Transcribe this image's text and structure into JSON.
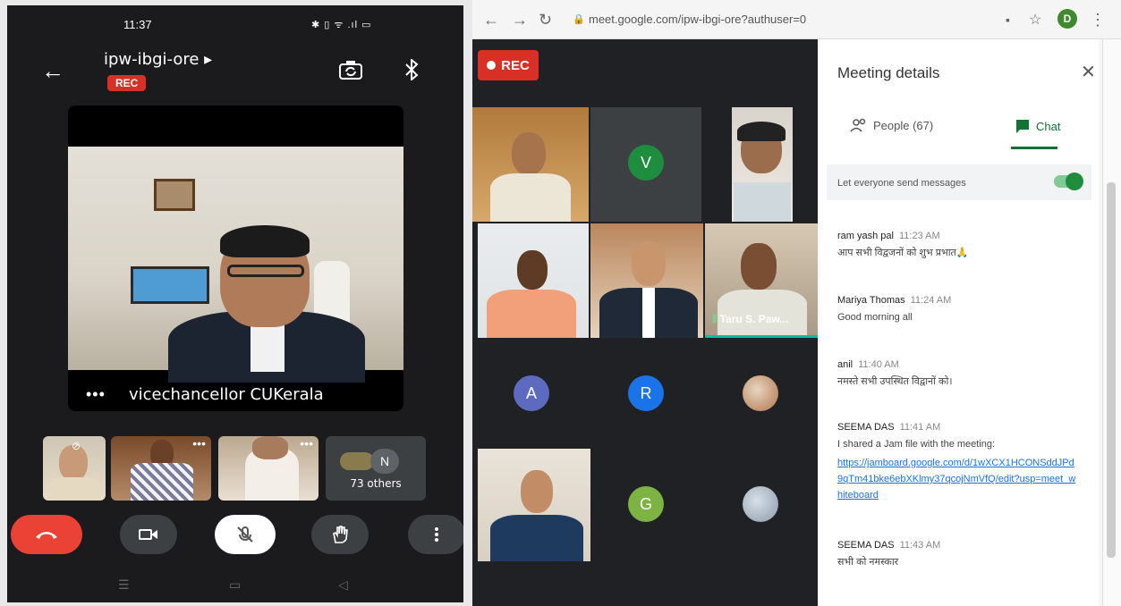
{
  "phone": {
    "status_time": "11:37",
    "status_icons": "✱ ▯ ᯤ .ıl ▭",
    "meeting_code": "ipw-ibgi-ore ▸",
    "rec_label": "REC",
    "main_speaker": "vicechancellor CUKerala",
    "more_dots": "•••",
    "others_initial": "N",
    "others_count": "73 others"
  },
  "browser": {
    "url": "meet.google.com/ipw-ibgi-ore?authuser=0",
    "avatar_initial": "D",
    "rec_label": "REC",
    "tiles": {
      "v": "V",
      "a": "A",
      "r": "R",
      "g": "G",
      "taru": "Taru S. Paw..."
    },
    "panel": {
      "title": "Meeting details",
      "people_tab": "People (67)",
      "chat_tab": "Chat",
      "toggle_label": "Let everyone send messages",
      "messages": [
        {
          "sender": "ram yash pal",
          "time": "11:23 AM",
          "text": "आप सभी विद्वजनों को शुभ प्रभात🙏"
        },
        {
          "sender": "Mariya Thomas",
          "time": "11:24 AM",
          "text": "Good morning all"
        },
        {
          "sender": "anil",
          "time": "11:40 AM",
          "text": "नमस्ते सभी उपस्थित विद्वानों को।"
        },
        {
          "sender": "SEEMA DAS",
          "time": "11:41 AM",
          "text": "I shared a Jam file with the meeting:",
          "link": "https://jamboard.google.com/d/1wXCX1HCONSddJPd9qTm41bke6ebXKlmy37qcojNmVfQ/edit?usp=meet_whiteboard"
        },
        {
          "sender": "SEEMA DAS",
          "time": "11:43 AM",
          "text": "सभी को नमस्कार"
        }
      ]
    }
  }
}
